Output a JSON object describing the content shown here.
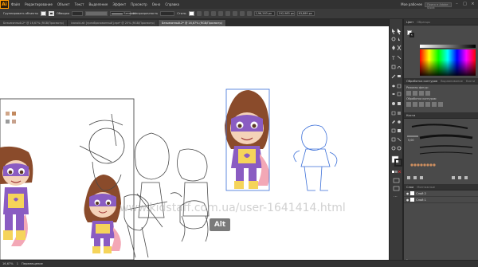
{
  "app": {
    "logo": "Ai",
    "menu": [
      "Файл",
      "Редактирование",
      "Объект",
      "Текст",
      "Выделение",
      "Эффект",
      "Просмотр",
      "Окно",
      "Справка"
    ],
    "workspace_label": "Мое рабочее",
    "search_placeholder": "Поиск в Adobe Stock"
  },
  "control_bar": {
    "object_label": "Группировать объекты",
    "fill_color": "#f2f2f2",
    "stroke_label": "Обводка",
    "brush_label": "Базовая",
    "opacity_label": "Непрозрачность",
    "style_label": "Стиль",
    "x_value": "2,96,283 px",
    "y_value": "192,983 px",
    "w_value": "63,889 px"
  },
  "doc_tabs": [
    {
      "label": "Безымянный-2* @ 16,67% (RGB/Просмотр)",
      "active": false
    },
    {
      "label": "ivanoid.ait [преобразованный].eps* @ 25% (RGB/Просмотр)",
      "active": false
    },
    {
      "label": "Безымянный-2* @ 16,67% (RGB/Просмотр)",
      "active": true
    }
  ],
  "panels": {
    "color_tabs": [
      "Цвет",
      "Образцы"
    ],
    "align_tabs": [
      "Обработка контуров",
      "Выравнивание",
      "Кисти"
    ],
    "pathfinder_label": "Режимы фигур:",
    "pathfinder_label2": "Обработка контуров:",
    "brushes_tab": "Кисти",
    "brush_size": "5,00",
    "layers_tabs": [
      "Слои",
      "Монтажные"
    ],
    "layers": [
      {
        "name": "Слой 2"
      },
      {
        "name": "Слой 1"
      }
    ],
    "layers_count": "2 слоя"
  },
  "status": {
    "zoom": "16,67%",
    "page": "1",
    "mode": "Перемещение"
  },
  "canvas": {
    "watermark": "www.kidstaff.com.ua/user-1641414.html",
    "alt_badge": "Alt",
    "palette": [
      "#d0a689",
      "#c2895e",
      "#9b9b9b",
      "#c7a18c"
    ]
  },
  "colors": {
    "accent": "#ff9a00",
    "suit_purple": "#8a5cc2",
    "suit_yellow": "#f5d45a",
    "hair": "#8a4b2b",
    "cape": "#f3a8b6",
    "sketch_line": "#4a4a4a",
    "sketch_blue": "#3b6fd8"
  }
}
